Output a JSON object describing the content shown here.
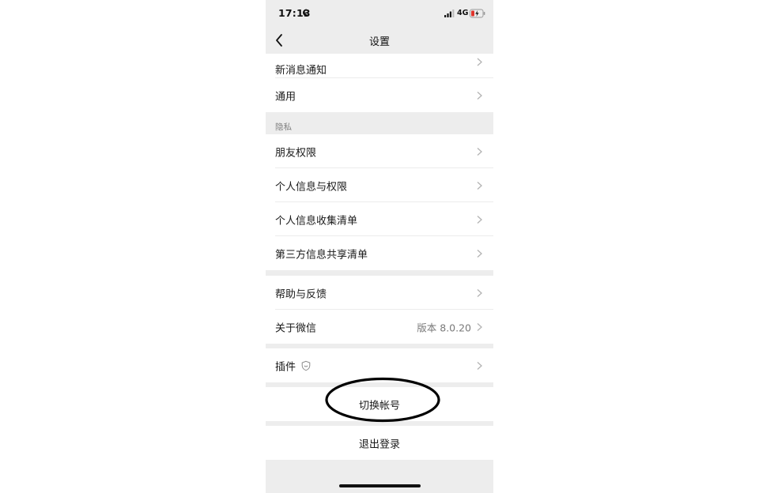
{
  "status_bar": {
    "time": "17:13",
    "network": "4G",
    "icons": [
      "moon-icon",
      "signal-icon",
      "battery-charging-icon"
    ]
  },
  "nav": {
    "title": "设置",
    "back_icon": "chevron-left-icon"
  },
  "rows": {
    "notifications": "新消息通知",
    "general": "通用",
    "friend_permissions": "朋友权限",
    "personal_info_permissions": "个人信息与权限",
    "personal_info_collection": "个人信息收集清单",
    "third_party_sharing": "第三方信息共享清单",
    "help_feedback": "帮助与反馈",
    "about_wechat": "关于微信",
    "about_version": "版本 8.0.20",
    "plugins": "插件"
  },
  "sections": {
    "privacy_header": "隐私"
  },
  "actions": {
    "switch_account": "切换帐号",
    "logout": "退出登录"
  },
  "colors": {
    "background": "#ededed",
    "cell": "#ffffff",
    "annotation": "#000000"
  }
}
